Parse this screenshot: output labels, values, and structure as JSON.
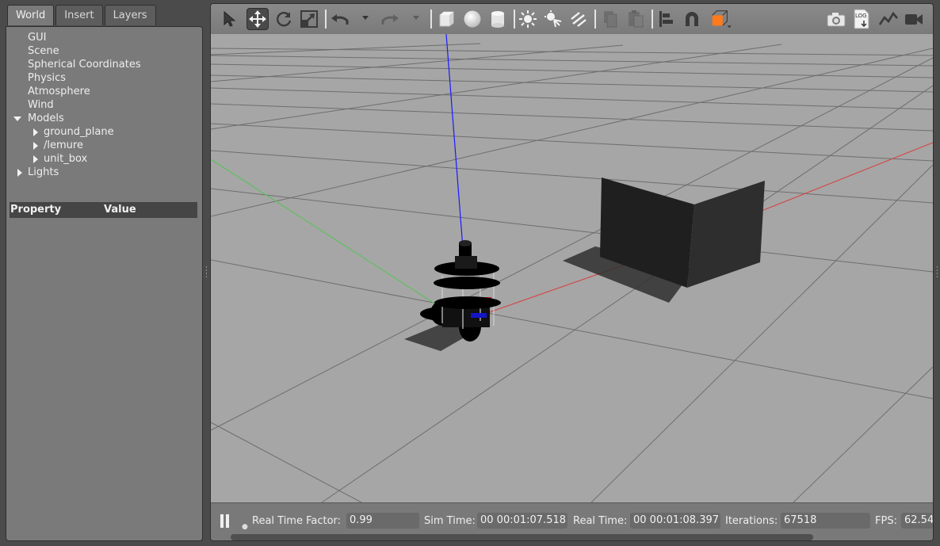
{
  "tabs": [
    {
      "label": "World",
      "active": true
    },
    {
      "label": "Insert",
      "active": false
    },
    {
      "label": "Layers",
      "active": false
    }
  ],
  "tree": [
    {
      "label": "GUI",
      "arrow": "none",
      "indent": 0
    },
    {
      "label": "Scene",
      "arrow": "none",
      "indent": 0
    },
    {
      "label": "Spherical Coordinates",
      "arrow": "none",
      "indent": 0
    },
    {
      "label": "Physics",
      "arrow": "none",
      "indent": 0
    },
    {
      "label": "Atmosphere",
      "arrow": "none",
      "indent": 0
    },
    {
      "label": "Wind",
      "arrow": "none",
      "indent": 0
    },
    {
      "label": "Models",
      "arrow": "down",
      "indent": 0
    },
    {
      "label": "ground_plane",
      "arrow": "right",
      "indent": 1
    },
    {
      "label": "/lemure",
      "arrow": "right",
      "indent": 1
    },
    {
      "label": "unit_box",
      "arrow": "right",
      "indent": 1
    },
    {
      "label": "Lights",
      "arrow": "right",
      "indent": 0
    }
  ],
  "property_table": {
    "col_property": "Property",
    "col_value": "Value"
  },
  "toolbar": {
    "icons": [
      "select-arrow-icon",
      "translate-icon",
      "rotate-icon",
      "scale-icon",
      "undo-icon",
      "redo-icon",
      "box-shape-icon",
      "sphere-shape-icon",
      "cylinder-shape-icon",
      "point-light-icon",
      "spot-light-icon",
      "directional-light-icon",
      "copy-icon",
      "paste-icon",
      "align-icon",
      "magnet-snap-icon",
      "view-angle-icon",
      "screenshot-icon",
      "log-icon",
      "plot-icon",
      "video-record-icon"
    ],
    "log_label": "LOG"
  },
  "status": {
    "real_time_factor_label": "Real Time Factor:",
    "real_time_factor": "0.99",
    "sim_time_label": "Sim Time:",
    "sim_time": "00 00:01:07.518",
    "real_time_label": "Real Time:",
    "real_time": "00 00:01:08.397",
    "iterations_label": "Iterations:",
    "iterations": "67518",
    "fps_label": "FPS:",
    "fps": "62.54"
  },
  "colors": {
    "viewport_bg": "#a6a6a6",
    "panel_bg": "#7a7a7a",
    "x_axis": "#d34a4a",
    "y_axis": "#5fbf5f",
    "z_axis": "#1a1aff",
    "box_dark": "#1f1f1f",
    "box_light": "#2e2e2e",
    "view_angle_orange": "#ff7a1a"
  }
}
